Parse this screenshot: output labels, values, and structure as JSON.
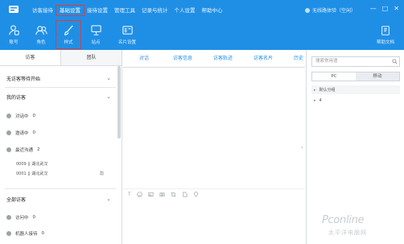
{
  "menu": {
    "items": [
      "访客接待",
      "基础设置",
      "接待设置",
      "管理工具",
      "记录与统计",
      "个人设置",
      "帮助中心"
    ],
    "active": "基础设置"
  },
  "status": {
    "text": "无线路体验（空闲）"
  },
  "window_controls": [
    "—",
    "□",
    "✕"
  ],
  "toolbar": {
    "items": [
      {
        "label": "账号",
        "icon": "person-icon"
      },
      {
        "label": "角色",
        "icon": "users-icon"
      },
      {
        "label": "样式",
        "icon": "brush-icon",
        "active": true
      },
      {
        "label": "站点",
        "icon": "monitor-icon"
      },
      {
        "label": "名片设置",
        "icon": "card-icon"
      }
    ],
    "help": {
      "label": "帮助文档",
      "icon": "book-icon"
    }
  },
  "left": {
    "tabs": [
      "访客",
      "团队"
    ],
    "sections": {
      "waiting": "无访客等待开始",
      "my_visitors": "我的访客",
      "all_visitors": "全部访客"
    },
    "my_rows": [
      {
        "label": "对话中",
        "count": "0"
      },
      {
        "label": "邀请中",
        "count": "0"
      },
      {
        "label": "最近沟通",
        "count": "2"
      }
    ],
    "recent": [
      {
        "text": "0009 || 湖北武汉",
        "extra": ""
      },
      {
        "text": "0001 || 湖北武汉",
        "extra": "隐"
      }
    ],
    "all_rows": [
      {
        "label": "访问中",
        "count": "0"
      },
      {
        "label": "机器人接待",
        "count": "0"
      }
    ]
  },
  "middle": {
    "tabs": [
      "对话",
      "访客信息",
      "访客轨迹",
      "访客名片",
      "历史"
    ]
  },
  "right": {
    "search": {
      "placeholder": "搜索常用语"
    },
    "tabs": [
      "PC",
      "移动"
    ],
    "groups": [
      "默认分组",
      "4"
    ]
  },
  "watermark": {
    "brand": "Pconline",
    "sub": "太平洋电脑网"
  },
  "colors": {
    "header": "#1f8fe6",
    "active_outline": "#e23b3b",
    "tab_text": "#1f8fe6"
  }
}
